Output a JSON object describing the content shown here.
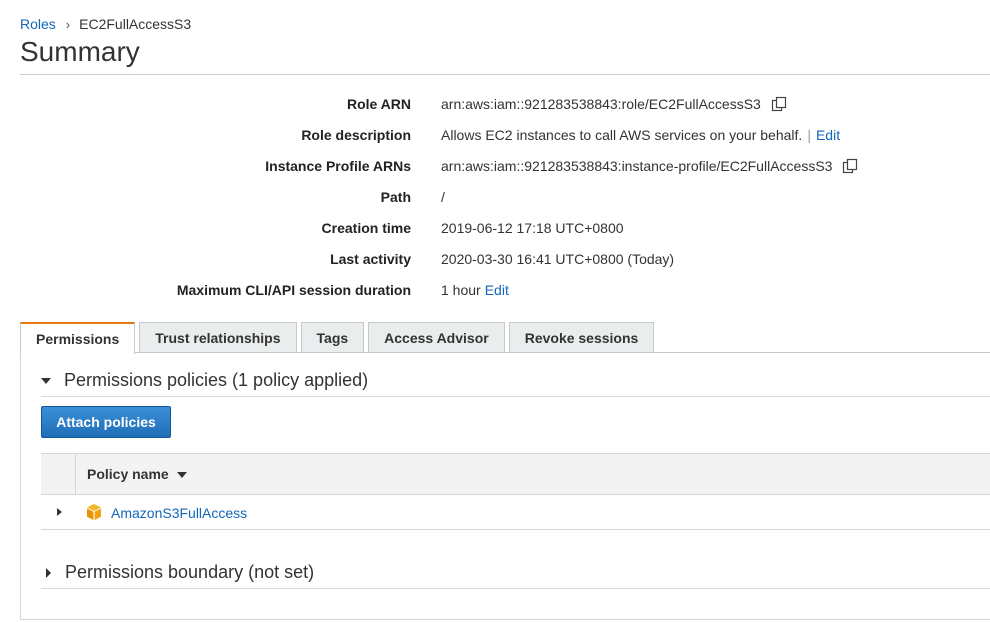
{
  "breadcrumb": {
    "parent": "Roles",
    "current": "EC2FullAccessS3"
  },
  "page_title": "Summary",
  "summary": {
    "role_arn": {
      "label": "Role ARN",
      "value": "arn:aws:iam::921283538843:role/EC2FullAccessS3",
      "copy_icon": "copy-icon"
    },
    "role_description": {
      "label": "Role description",
      "value": "Allows EC2 instances to call AWS services on your behalf.",
      "separator": "|",
      "edit": "Edit"
    },
    "instance_profile_arns": {
      "label": "Instance Profile ARNs",
      "value": "arn:aws:iam::921283538843:instance-profile/EC2FullAccessS3",
      "copy_icon": "copy-icon"
    },
    "path": {
      "label": "Path",
      "value": "/"
    },
    "creation_time": {
      "label": "Creation time",
      "value": "2019-06-12 17:18 UTC+0800"
    },
    "last_activity": {
      "label": "Last activity",
      "value": "2020-03-30 16:41 UTC+0800 (Today)"
    },
    "max_session": {
      "label": "Maximum CLI/API session duration",
      "value": "1 hour",
      "edit": "Edit"
    }
  },
  "tabs": [
    {
      "label": "Permissions",
      "active": true
    },
    {
      "label": "Trust relationships",
      "active": false
    },
    {
      "label": "Tags",
      "active": false
    },
    {
      "label": "Access Advisor",
      "active": false
    },
    {
      "label": "Revoke sessions",
      "active": false
    }
  ],
  "permissions": {
    "heading": "Permissions policies (1 policy applied)",
    "attach_button": "Attach policies",
    "table": {
      "column_header": "Policy name",
      "rows": [
        {
          "name": "AmazonS3FullAccess",
          "icon": "aws-managed-policy-icon"
        }
      ]
    },
    "boundary_heading": "Permissions boundary (not set)"
  },
  "colors": {
    "link": "#1166bb",
    "active_tab_accent": "#e47911",
    "primary_button": "#1f6fb9",
    "policy_icon": "#f0a30a"
  }
}
